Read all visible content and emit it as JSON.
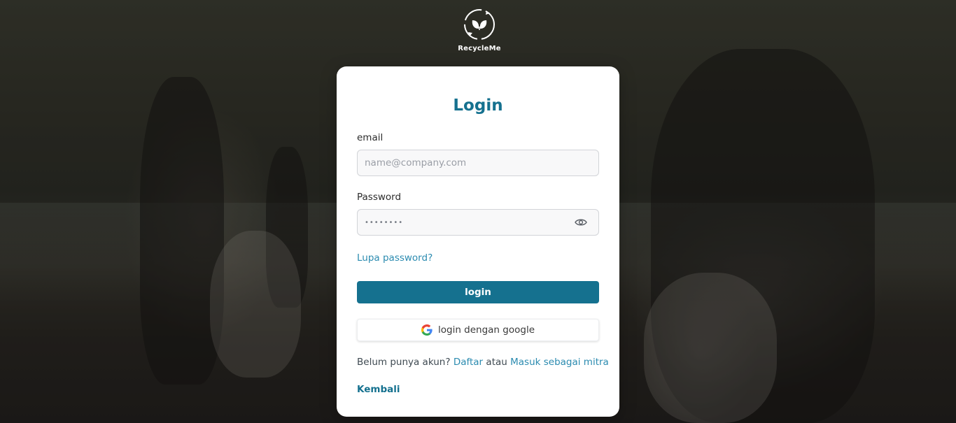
{
  "brand": {
    "name": "RecycleMe",
    "logo_icon": "recycle-leaf-icon"
  },
  "login_card": {
    "title": "Login",
    "email": {
      "label": "email",
      "placeholder": "name@company.com",
      "value": ""
    },
    "password": {
      "label": "Password",
      "value": "••••••••",
      "toggle_icon": "eye-icon"
    },
    "forgot_password": "Lupa password?",
    "submit_label": "login",
    "google": {
      "label": "login dengan google",
      "icon": "google-icon"
    },
    "signup": {
      "prompt": "Belum punya akun?",
      "register_link": "Daftar",
      "connector": "atau",
      "partner_link": "Masuk sebagai mitra"
    },
    "back_link": "Kembali"
  },
  "colors": {
    "primary": "#15718f",
    "link": "#2b8bb0",
    "card_bg": "#ffffff",
    "input_bg": "#f8f8f9"
  }
}
